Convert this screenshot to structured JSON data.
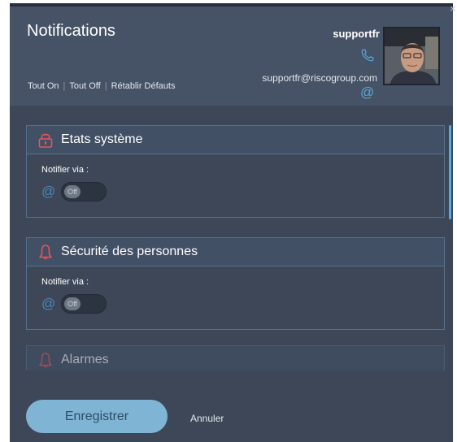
{
  "dialog": {
    "title": "Notifications",
    "close_glyph": "×",
    "actions": {
      "all_on": "Tout On",
      "all_off": "Tout Off",
      "reset": "Rétablir Défauts",
      "separator": "|"
    }
  },
  "user": {
    "name": "supportfr",
    "email": "supportfr@riscogroup.com",
    "phone_icon": "phone-icon",
    "email_icon": "at-icon",
    "at_glyph": "@"
  },
  "sections": [
    {
      "title": "Etats système",
      "icon": "padlock-icon",
      "notify_label": "Notifier via :",
      "at_glyph": "@",
      "toggle_label": "Off"
    },
    {
      "title": "Sécurité des personnes",
      "icon": "bell-icon",
      "notify_label": "Notifier via :",
      "at_glyph": "@",
      "toggle_label": "Off"
    },
    {
      "title": "Alarmes",
      "icon": "bell-icon"
    }
  ],
  "footer": {
    "save_label": "Enregistrer",
    "cancel_label": "Annuler"
  },
  "colors": {
    "accent": "#5aa9e0",
    "icon_red": "#e8535a",
    "panel": "#3d4758"
  }
}
